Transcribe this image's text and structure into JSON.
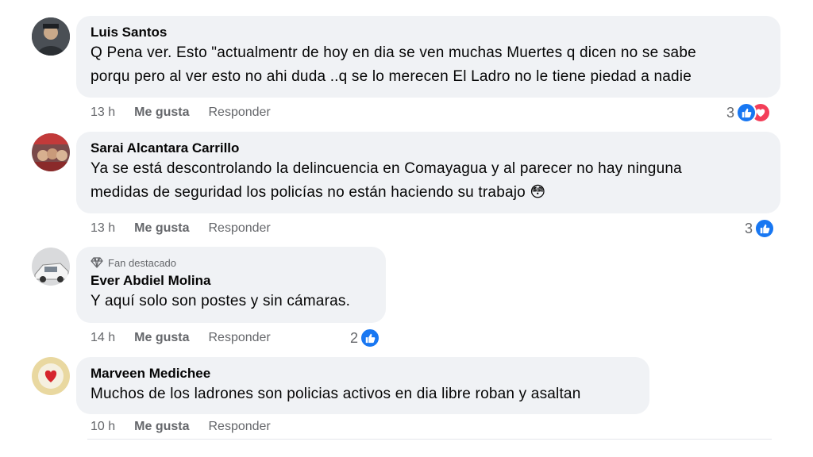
{
  "comments": [
    {
      "author": "Luis Santos",
      "text_lines": [
        "Q Pena ver. Esto \"actualmentr de hoy en dia se ven muchas Muertes q dicen no se sabe",
        "porqu pero al ver esto no ahi duda ..q se lo merecen El Ladro no le tiene piedad a nadie"
      ],
      "time": "13 h",
      "like_label": "Me gusta",
      "reply_label": "Responder",
      "reaction_count": "3",
      "reactions": [
        "like-icon",
        "love-icon"
      ]
    },
    {
      "author": "Sarai Alcantara Carrillo",
      "text_lines": [
        "Ya se está descontrolando la delincuencia en Comayagua y al parecer no hay ninguna",
        "medidas de seguridad los policías no están haciendo su trabajo"
      ],
      "emoji": "😳",
      "time": "13 h",
      "like_label": "Me gusta",
      "reply_label": "Responder",
      "reaction_count": "3",
      "reactions": [
        "like-icon"
      ]
    },
    {
      "badge": "Fan destacado",
      "author": "Ever Abdiel Molina",
      "text_lines": [
        "Y aquí solo son postes y sin cámaras."
      ],
      "time": "14 h",
      "like_label": "Me gusta",
      "reply_label": "Responder",
      "reaction_count": "2",
      "reactions": [
        "like-icon"
      ]
    },
    {
      "author": "Marveen Medichee",
      "text_lines": [
        "Muchos de los ladrones son policias activos en dia libre roban y asaltan"
      ],
      "time": "10 h",
      "like_label": "Me gusta",
      "reply_label": "Responder"
    }
  ],
  "colors": {
    "bubble": "#f0f2f5",
    "meta_text": "#65676b",
    "like_blue": "#1877f2",
    "love_red": "#f33e58"
  }
}
